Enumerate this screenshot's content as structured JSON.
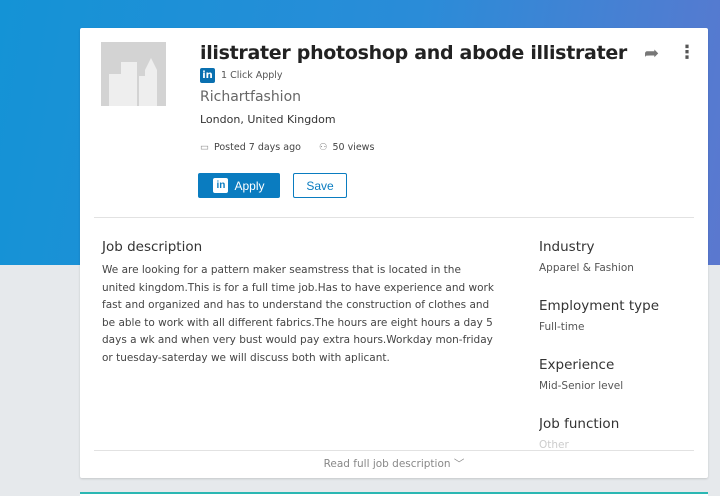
{
  "job": {
    "title": "ilistrater photoshop and abode illistrater",
    "one_click": "1 Click Apply",
    "company": "Richartfashion",
    "location": "London, United Kingdom",
    "posted": "Posted 7 days ago",
    "views": "50 views"
  },
  "actions": {
    "apply": "Apply",
    "save": "Save",
    "li_badge": "in"
  },
  "description": {
    "heading": "Job description",
    "body": "We are looking for a pattern maker seamstress that is located in the united kingdom.This is for a full time job.Has to have experience and work fast and organized and has to understand the construction of clothes and be able to work with all different fabrics.The hours are eight hours a day 5 days a wk and when very bust would pay extra hours.Workday mon-friday or tuesday-saterday we will discuss both with aplicant."
  },
  "details": [
    {
      "label": "Industry",
      "value": "Apparel & Fashion"
    },
    {
      "label": "Employment type",
      "value": "Full-time"
    },
    {
      "label": "Experience",
      "value": "Mid-Senior level"
    },
    {
      "label": "Job function",
      "value": "Other"
    }
  ],
  "read_more": "Read full job description",
  "colors": {
    "brand": "#0a7cc0",
    "accent": "#2bb7b3"
  }
}
